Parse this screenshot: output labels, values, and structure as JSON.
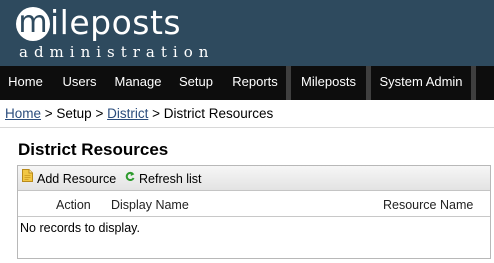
{
  "brand": {
    "logo_letter": "m",
    "logo_text": "ileposts",
    "subtitle": "administration"
  },
  "nav": {
    "items": [
      {
        "label": "Home"
      },
      {
        "label": "Users"
      },
      {
        "label": "Manage"
      },
      {
        "label": "Setup"
      },
      {
        "label": "Reports"
      },
      {
        "label": "Mileposts"
      },
      {
        "label": "System Admin"
      }
    ]
  },
  "breadcrumb": {
    "home": "Home",
    "sep1": " > ",
    "setup": "Setup",
    "sep2": " > ",
    "district": "District",
    "sep3": " > ",
    "current": "District Resources"
  },
  "page": {
    "title": "District Resources"
  },
  "grid": {
    "toolbar": {
      "add_label": "Add Resource",
      "refresh_label": "Refresh list"
    },
    "columns": {
      "action": "Action",
      "display_name": "Display Name",
      "resource_name": "Resource Name"
    },
    "empty_message": "No records to display."
  },
  "colors": {
    "header_bg": "#2e4a5e",
    "nav_bg": "#0d0d0d",
    "link": "#2a4c7c"
  },
  "icons": {
    "add": "add-document-icon",
    "refresh": "refresh-icon"
  }
}
